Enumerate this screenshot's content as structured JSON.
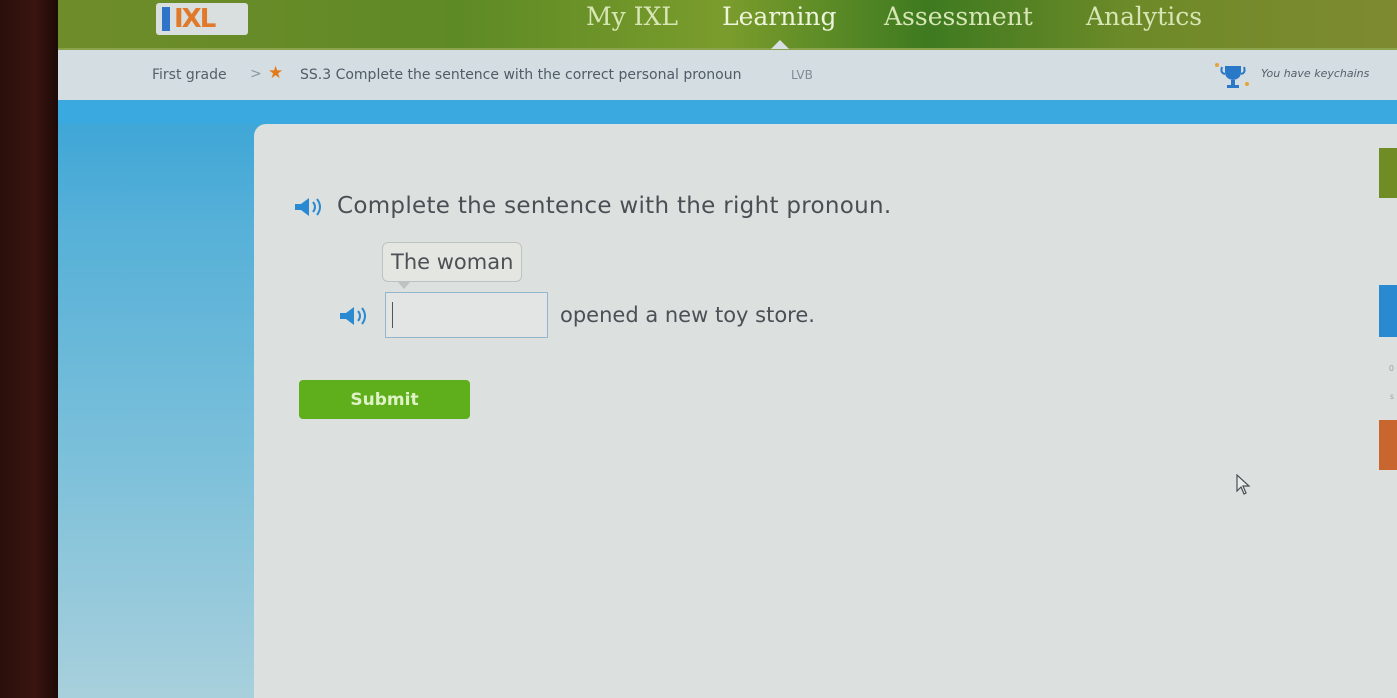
{
  "nav": {
    "logo": "IXL",
    "items": [
      {
        "label": "My IXL",
        "active": false
      },
      {
        "label": "Learning",
        "active": true
      },
      {
        "label": "Assessment",
        "active": false
      },
      {
        "label": "Analytics",
        "active": false
      }
    ]
  },
  "breadcrumb": {
    "grade": "First grade",
    "separator": ">",
    "skill": "SS.3 Complete the sentence with the correct personal pronoun",
    "code": "LVB"
  },
  "award": {
    "icon": "trophy-icon",
    "text": "You have keychains"
  },
  "question": {
    "instruction": "Complete the sentence with the right pronoun.",
    "hint_bubble": "The woman",
    "answer_value": "",
    "sentence_rest": "opened a new toy store."
  },
  "buttons": {
    "submit": "Submit"
  },
  "colors": {
    "nav_green": "#6f8c2a",
    "accent_blue": "#3aa9df",
    "submit_green": "#5fae1c",
    "star_orange": "#e27a1c",
    "speaker_blue": "#2a8ad1"
  }
}
